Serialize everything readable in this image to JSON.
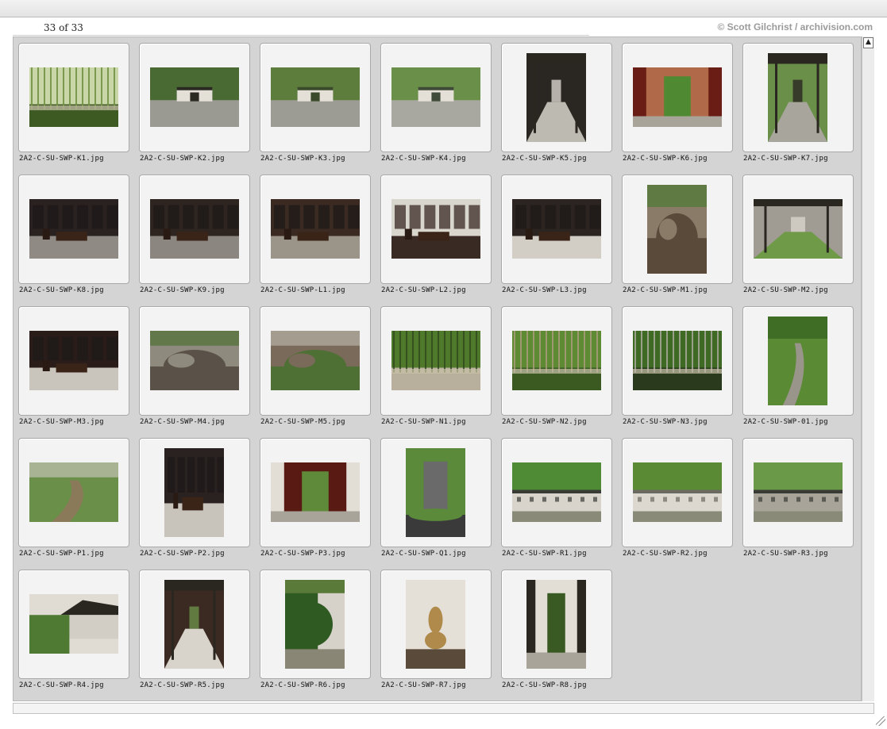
{
  "header": {
    "counter": "33 of 33",
    "credit": "© Scott Gilchrist / archivision.com"
  },
  "scrollbar": {
    "top_button_icon": "scroll-to-top-icon"
  },
  "thumbnails": [
    {
      "name": "2A2-C-SU-SWP-K1.jpg",
      "orientation": "landscape",
      "scene": "bamboo",
      "colors": [
        "#c9d6a8",
        "#6f8f3f",
        "#3d5a22"
      ]
    },
    {
      "name": "2A2-C-SU-SWP-K2.jpg",
      "orientation": "landscape",
      "scene": "courtyard",
      "colors": [
        "#4a6a34",
        "#9a9a92",
        "#2a2a22"
      ]
    },
    {
      "name": "2A2-C-SU-SWP-K3.jpg",
      "orientation": "landscape",
      "scene": "courtyard",
      "colors": [
        "#5c7d3c",
        "#9c9c94",
        "#3a4a2a"
      ]
    },
    {
      "name": "2A2-C-SU-SWP-K4.jpg",
      "orientation": "landscape",
      "scene": "courtyard",
      "colors": [
        "#6a8f48",
        "#a8a8a0",
        "#404a38"
      ]
    },
    {
      "name": "2A2-C-SU-SWP-K5.jpg",
      "orientation": "portrait",
      "scene": "corridor",
      "colors": [
        "#2a2622",
        "#bdbab2",
        "#d9d6ce"
      ]
    },
    {
      "name": "2A2-C-SU-SWP-K6.jpg",
      "orientation": "landscape",
      "scene": "doorway",
      "colors": [
        "#6a1d14",
        "#b06a4a",
        "#4f8a32"
      ]
    },
    {
      "name": "2A2-C-SU-SWP-K7.jpg",
      "orientation": "portrait",
      "scene": "corridor",
      "colors": [
        "#6a8f48",
        "#a8a59c",
        "#2a2622"
      ]
    },
    {
      "name": "2A2-C-SU-SWP-K8.jpg",
      "orientation": "landscape",
      "scene": "interior",
      "colors": [
        "#2a2220",
        "#8f8a84",
        "#c8c2b8"
      ]
    },
    {
      "name": "2A2-C-SU-SWP-K9.jpg",
      "orientation": "landscape",
      "scene": "interior",
      "colors": [
        "#2e2420",
        "#8c8680",
        "#bdb6ac"
      ]
    },
    {
      "name": "2A2-C-SU-SWP-L1.jpg",
      "orientation": "landscape",
      "scene": "interior",
      "colors": [
        "#3a2a22",
        "#9b9488",
        "#6a5a48"
      ]
    },
    {
      "name": "2A2-C-SU-SWP-L2.jpg",
      "orientation": "landscape",
      "scene": "interior",
      "colors": [
        "#d9d6ce",
        "#3a2a24",
        "#9a948a"
      ]
    },
    {
      "name": "2A2-C-SU-SWP-L3.jpg",
      "orientation": "landscape",
      "scene": "interior",
      "colors": [
        "#2c2420",
        "#d2cec6",
        "#8a847a"
      ]
    },
    {
      "name": "2A2-C-SU-SWP-M1.jpg",
      "orientation": "portrait",
      "scene": "rockery",
      "colors": [
        "#8a7a68",
        "#5a4a3a",
        "#4f7a34"
      ]
    },
    {
      "name": "2A2-C-SU-SWP-M2.jpg",
      "orientation": "landscape",
      "scene": "corridor",
      "colors": [
        "#a09c94",
        "#6f9a48",
        "#d8d4cc"
      ]
    },
    {
      "name": "2A2-C-SU-SWP-M3.jpg",
      "orientation": "landscape",
      "scene": "interior",
      "colors": [
        "#2a1c18",
        "#c9c4bc",
        "#6a1d14"
      ]
    },
    {
      "name": "2A2-C-SU-SWP-M4.jpg",
      "orientation": "landscape",
      "scene": "rockery",
      "colors": [
        "#8f8a7e",
        "#5a5248",
        "#4f7034"
      ]
    },
    {
      "name": "2A2-C-SU-SWP-M5.jpg",
      "orientation": "landscape",
      "scene": "rockery",
      "colors": [
        "#7a6a5a",
        "#4f7034",
        "#b8b2a6"
      ]
    },
    {
      "name": "2A2-C-SU-SWP-N1.jpg",
      "orientation": "landscape",
      "scene": "bamboo",
      "colors": [
        "#4f7a2c",
        "#2f4a1c",
        "#b8b09c"
      ]
    },
    {
      "name": "2A2-C-SU-SWP-N2.jpg",
      "orientation": "landscape",
      "scene": "bamboo",
      "colors": [
        "#5f8a34",
        "#a89a7a",
        "#3a5a22"
      ]
    },
    {
      "name": "2A2-C-SU-SWP-N3.jpg",
      "orientation": "landscape",
      "scene": "bamboo",
      "colors": [
        "#3f6a24",
        "#a8a89c",
        "#2a3a1c"
      ]
    },
    {
      "name": "2A2-C-SU-SWP-01.jpg",
      "orientation": "portrait",
      "scene": "path",
      "colors": [
        "#5a8a34",
        "#9a958a",
        "#2f5a1c"
      ]
    },
    {
      "name": "2A2-C-SU-SWP-P1.jpg",
      "orientation": "landscape",
      "scene": "path",
      "colors": [
        "#6a8f48",
        "#8a7a5a",
        "#d0ccc4"
      ]
    },
    {
      "name": "2A2-C-SU-SWP-P2.jpg",
      "orientation": "portrait",
      "scene": "interior",
      "colors": [
        "#2a2220",
        "#c8c4bc",
        "#8a8478"
      ]
    },
    {
      "name": "2A2-C-SU-SWP-P3.jpg",
      "orientation": "landscape",
      "scene": "doorway",
      "colors": [
        "#e2ded6",
        "#5a1a14",
        "#5f8a3a"
      ]
    },
    {
      "name": "2A2-C-SU-SWP-Q1.jpg",
      "orientation": "portrait",
      "scene": "stele",
      "colors": [
        "#5a8a3a",
        "#6a6a6a",
        "#3a3a3a"
      ]
    },
    {
      "name": "2A2-C-SU-SWP-R1.jpg",
      "orientation": "landscape",
      "scene": "wall",
      "colors": [
        "#4f8a34",
        "#d8d4cc",
        "#3a3a34"
      ]
    },
    {
      "name": "2A2-C-SU-SWP-R2.jpg",
      "orientation": "landscape",
      "scene": "wall",
      "colors": [
        "#5a8a34",
        "#dcd8d0",
        "#6a6a60"
      ]
    },
    {
      "name": "2A2-C-SU-SWP-R3.jpg",
      "orientation": "landscape",
      "scene": "wall",
      "colors": [
        "#6a9a48",
        "#a8a49a",
        "#3a3a34"
      ]
    },
    {
      "name": "2A2-C-SU-SWP-R4.jpg",
      "orientation": "landscape",
      "scene": "pavilion",
      "colors": [
        "#e0dcd4",
        "#4f7a34",
        "#2a2620"
      ]
    },
    {
      "name": "2A2-C-SU-SWP-R5.jpg",
      "orientation": "portrait",
      "scene": "corridor",
      "colors": [
        "#3a2a22",
        "#d8d4cc",
        "#6a8f48"
      ]
    },
    {
      "name": "2A2-C-SU-SWP-R6.jpg",
      "orientation": "portrait",
      "scene": "tree",
      "colors": [
        "#2f5a22",
        "#d6d2ca",
        "#5a7a3a"
      ]
    },
    {
      "name": "2A2-C-SU-SWP-R7.jpg",
      "orientation": "portrait",
      "scene": "sculpture",
      "colors": [
        "#e4e0d8",
        "#b08a4a",
        "#5a4a3a"
      ]
    },
    {
      "name": "2A2-C-SU-SWP-R8.jpg",
      "orientation": "portrait",
      "scene": "doorway",
      "colors": [
        "#2a2620",
        "#e2ded6",
        "#3a5a24"
      ]
    }
  ]
}
